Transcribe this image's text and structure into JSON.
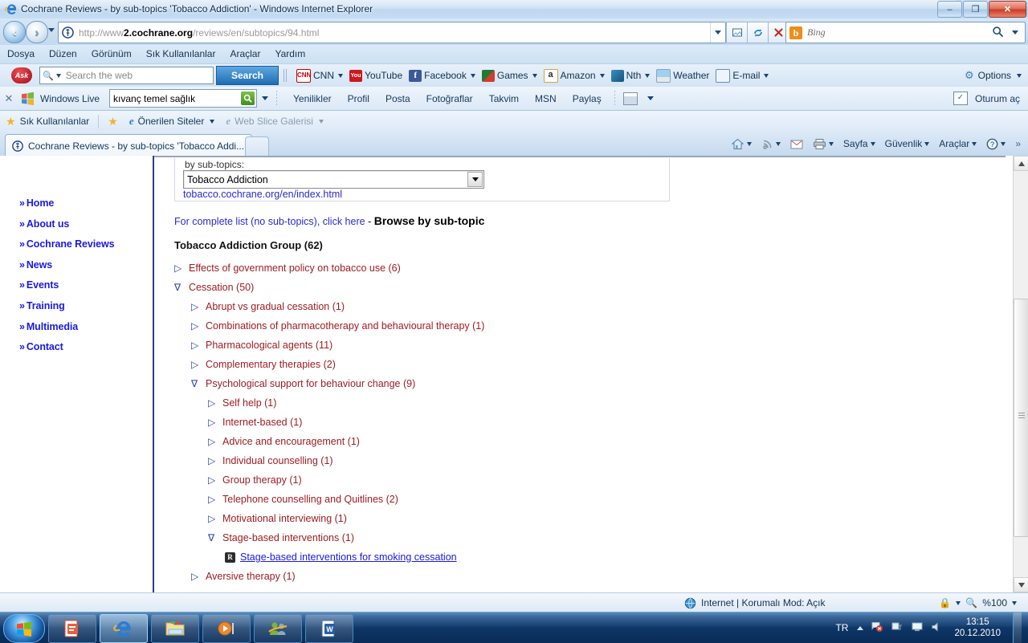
{
  "window": {
    "title": "Cochrane Reviews - by sub-topics 'Tobacco Addiction' - Windows Internet Explorer",
    "minimize": "–",
    "restore": "❐",
    "close": "✕"
  },
  "nav": {
    "back": "◀",
    "forward": "▶",
    "url_protocol": "http://www",
    "url_host_prefix": "2.",
    "url_domain": "cochrane.org",
    "url_path": "/reviews/en/subtopics/94.html",
    "url_full": "http://www2.cochrane.org/reviews/en/subtopics/94.html",
    "buttons": [
      {
        "name": "compatibility-view-button",
        "glyph": "❑"
      },
      {
        "name": "refresh-button",
        "glyph": "↻"
      },
      {
        "name": "stop-button",
        "glyph": "✕"
      }
    ],
    "search_provider": "Bing",
    "search_placeholder": "Bing"
  },
  "menubar": {
    "items": [
      "Dosya",
      "Düzen",
      "Görünüm",
      "Sık Kullanılanlar",
      "Araçlar",
      "Yardım"
    ]
  },
  "ask_toolbar": {
    "logo": "Ask",
    "search_placeholder": "Search the web",
    "search_button": "Search",
    "links": [
      {
        "label": "CNN",
        "icon": "cnn-icon",
        "color": "#cc0000",
        "caret": true
      },
      {
        "label": "YouTube",
        "icon": "youtube-icon",
        "color": "#cc181e",
        "caret": false
      },
      {
        "label": "Facebook",
        "icon": "facebook-icon",
        "color": "#3b5998",
        "caret": true
      },
      {
        "label": "Games",
        "icon": "games-icon",
        "color": "#217a3a",
        "caret": true
      },
      {
        "label": "Amazon",
        "icon": "amazon-icon",
        "color": "#f0a030",
        "caret": true
      },
      {
        "label": "Nth",
        "icon": "nth-icon",
        "color": "#1c6ba0",
        "caret": true
      },
      {
        "label": "Weather",
        "icon": "weather-icon",
        "color": "#7fb8e0",
        "caret": false
      },
      {
        "label": "E-mail",
        "icon": "email-icon",
        "color": "#5d8fc0",
        "caret": true
      }
    ],
    "options_label": "Options"
  },
  "live_toolbar": {
    "close": "✕",
    "brand": "Windows Live",
    "search_value": "kıvanç temel sağlık",
    "links": [
      "Yenilikler",
      "Profil",
      "Posta",
      "Fotoğraflar",
      "Takvim",
      "MSN",
      "Paylaş"
    ],
    "signin": "Oturum aç"
  },
  "favorites_bar": {
    "favorites_label": "Sık Kullanılanlar",
    "suggested_sites": "Önerilen Siteler",
    "web_slice": "Web Slice Galerisi"
  },
  "tabs": {
    "active_tab": "Cochrane Reviews - by sub-topics 'Tobacco Addi...",
    "new_tab_tooltip": ""
  },
  "command_bar": {
    "items": [
      {
        "label": "",
        "icon": "home-icon",
        "caret": true
      },
      {
        "label": "",
        "icon": "feeds-icon",
        "caret": true
      },
      {
        "label": "",
        "icon": "mail-icon",
        "caret": false
      },
      {
        "label": "",
        "icon": "print-icon",
        "caret": true
      },
      {
        "label": "Sayfa",
        "icon": "",
        "caret": true
      },
      {
        "label": "Güvenlik",
        "icon": "",
        "caret": true
      },
      {
        "label": "Araçlar",
        "icon": "",
        "caret": true
      },
      {
        "label": "",
        "icon": "help-icon",
        "caret": true
      }
    ],
    "overflow": "»"
  },
  "sidebar": {
    "items": [
      {
        "chev": "»",
        "label": "Home"
      },
      {
        "chev": "»",
        "label": "About us"
      },
      {
        "chev": "»",
        "label": "Cochrane Reviews"
      },
      {
        "chev": "»",
        "label": "News"
      },
      {
        "chev": "»",
        "label": "Events"
      },
      {
        "chev": "»",
        "label": "Training"
      },
      {
        "chev": "»",
        "label": "Multimedia"
      },
      {
        "chev": "»",
        "label": "Contact"
      }
    ]
  },
  "page": {
    "info_caption": "by sub-topics:",
    "select_value": "Tobacco Addiction",
    "group_link": "tobacco.cochrane.org/en/index.html",
    "complete_list_link": "For complete list (no sub-topics), click here",
    "separator": " - ",
    "browse_heading": "Browse by sub-topic",
    "tree_title": "Tobacco Addiction Group (62)",
    "tree": [
      {
        "level": 0,
        "marker": "▷",
        "label": "Effects of government policy on tobacco use (6)",
        "type": "node"
      },
      {
        "level": 0,
        "marker": "∇",
        "label": "Cessation (50)",
        "type": "node"
      },
      {
        "level": 1,
        "marker": "▷",
        "label": "Abrupt vs gradual cessation (1)",
        "type": "node"
      },
      {
        "level": 1,
        "marker": "▷",
        "label": "Combinations of pharmacotherapy and behavioural therapy (1)",
        "type": "node"
      },
      {
        "level": 1,
        "marker": "▷",
        "label": "Pharmacological agents (11)",
        "type": "node"
      },
      {
        "level": 1,
        "marker": "▷",
        "label": "Complementary therapies (2)",
        "type": "node"
      },
      {
        "level": 1,
        "marker": "∇",
        "label": "Psychological support for behaviour change (9)",
        "type": "node"
      },
      {
        "level": 2,
        "marker": "▷",
        "label": "Self help (1)",
        "type": "node"
      },
      {
        "level": 2,
        "marker": "▷",
        "label": "Internet-based (1)",
        "type": "node"
      },
      {
        "level": 2,
        "marker": "▷",
        "label": "Advice and encouragement (1)",
        "type": "node"
      },
      {
        "level": 2,
        "marker": "▷",
        "label": "Individual counselling (1)",
        "type": "node"
      },
      {
        "level": 2,
        "marker": "▷",
        "label": "Group therapy (1)",
        "type": "node"
      },
      {
        "level": 2,
        "marker": "▷",
        "label": "Telephone counselling and Quitlines (2)",
        "type": "node"
      },
      {
        "level": 2,
        "marker": "▷",
        "label": "Motivational interviewing (1)",
        "type": "node"
      },
      {
        "level": 2,
        "marker": "∇",
        "label": "Stage-based interventions (1)",
        "type": "node"
      },
      {
        "level": 3,
        "marker": "R",
        "label": "Stage-based interventions for smoking cessation",
        "type": "leaf"
      },
      {
        "level": 1,
        "marker": "▷",
        "label": "Aversive therapy (1)",
        "type": "node"
      }
    ]
  },
  "statusbar": {
    "zone": "Internet | Korumalı Mod: Açık",
    "zoom": "%100"
  },
  "taskbar": {
    "start": "start-orb",
    "buttons": [
      {
        "name": "taskbar-powerpoint",
        "icon": "powerpoint-icon",
        "active": false
      },
      {
        "name": "taskbar-internet-explorer",
        "icon": "ie-icon",
        "active": true
      },
      {
        "name": "taskbar-windows-explorer",
        "icon": "folder-icon",
        "active": false
      },
      {
        "name": "taskbar-media-player",
        "icon": "media-player-icon",
        "active": false
      },
      {
        "name": "taskbar-messenger",
        "icon": "messenger-icon",
        "active": false
      },
      {
        "name": "taskbar-word",
        "icon": "word-icon",
        "active": false
      }
    ],
    "language": "TR",
    "clock_time": "13:15",
    "clock_date": "20.12.2010"
  },
  "colors": {
    "link": "#1a1ae0",
    "tree_label": "#9d1d24",
    "tree_marker": "#2b3ea8",
    "sidebar_border": "#2b3e8f"
  }
}
